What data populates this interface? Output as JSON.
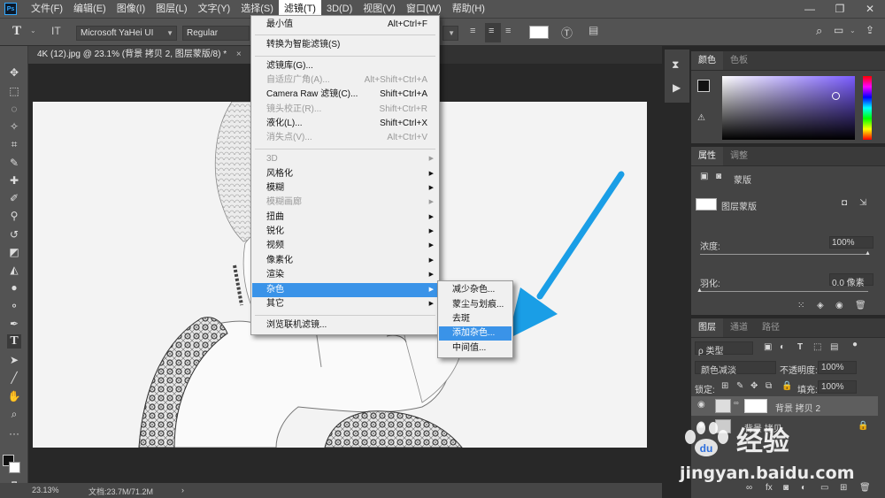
{
  "menubar": {
    "logo": "Ps",
    "items": [
      "文件(F)",
      "编辑(E)",
      "图像(I)",
      "图层(L)",
      "文字(Y)",
      "选择(S)",
      "滤镜(T)",
      "3D(D)",
      "视图(V)",
      "窗口(W)",
      "帮助(H)"
    ],
    "active_index": 6
  },
  "options": {
    "font_family": "Microsoft YaHei UI",
    "font_style": "Regular",
    "text_color": "#ffffff"
  },
  "document": {
    "tab_title": "4K (12).jpg @ 23.1% (背景 拷贝 2, 图层蒙版/8) *",
    "tab_close": "×"
  },
  "status": {
    "zoom": "23.13%",
    "doc_size": "文档:23.7M/71.2M",
    "arrow": "›"
  },
  "filter_menu": {
    "items": [
      {
        "label": "最小值",
        "shortcut": "Alt+Ctrl+F",
        "disabled": false
      },
      {
        "label": "转换为智能滤镜(S)",
        "shortcut": "",
        "disabled": false
      },
      {
        "label": "滤镜库(G)...",
        "shortcut": "",
        "disabled": false
      },
      {
        "label": "自适应广角(A)...",
        "shortcut": "Alt+Shift+Ctrl+A",
        "disabled": true
      },
      {
        "label": "Camera Raw 滤镜(C)...",
        "shortcut": "Shift+Ctrl+A",
        "disabled": false
      },
      {
        "label": "镜头校正(R)...",
        "shortcut": "Shift+Ctrl+R",
        "disabled": true
      },
      {
        "label": "液化(L)...",
        "shortcut": "Shift+Ctrl+X",
        "disabled": false
      },
      {
        "label": "消失点(V)...",
        "shortcut": "Alt+Ctrl+V",
        "disabled": true
      },
      {
        "label": "3D",
        "submenu": true,
        "disabled": true
      },
      {
        "label": "风格化",
        "submenu": true,
        "disabled": false
      },
      {
        "label": "模糊",
        "submenu": true,
        "disabled": false
      },
      {
        "label": "模糊画廊",
        "submenu": true,
        "disabled": true
      },
      {
        "label": "扭曲",
        "submenu": true,
        "disabled": false
      },
      {
        "label": "锐化",
        "submenu": true,
        "disabled": false
      },
      {
        "label": "视频",
        "submenu": true,
        "disabled": false
      },
      {
        "label": "像素化",
        "submenu": true,
        "disabled": false
      },
      {
        "label": "渲染",
        "submenu": true,
        "disabled": false
      },
      {
        "label": "杂色",
        "submenu": true,
        "disabled": false,
        "highlighted": true
      },
      {
        "label": "其它",
        "submenu": true,
        "disabled": false
      },
      {
        "label": "浏览联机滤镜...",
        "shortcut": "",
        "disabled": false
      }
    ],
    "submenu_arrow": "▶"
  },
  "noise_submenu": {
    "items": [
      "减少杂色...",
      "蒙尘与划痕...",
      "去斑",
      "添加杂色...",
      "中间值..."
    ],
    "highlighted_index": 3
  },
  "color_panel": {
    "tabs": [
      "颜色",
      "色板"
    ],
    "hue_color": "#7a5cff"
  },
  "properties_panel": {
    "tabs": [
      "属性",
      "调整"
    ],
    "mask_label": "蒙版",
    "layer_mask_label": "图层蒙版",
    "density_label": "浓度:",
    "density_value": "100%",
    "feather_label": "羽化:",
    "feather_value": "0.0 像素",
    "density_fraction": 1.0,
    "feather_fraction": 0.0
  },
  "layers_panel": {
    "tabs": [
      "图层",
      "通道",
      "路径"
    ],
    "filter_kind": "ρ 类型",
    "blend_mode": "颜色减淡",
    "opacity_label": "不透明度:",
    "opacity_value": "100%",
    "lock_label": "锁定:",
    "fill_label": "填充:",
    "fill_value": "100%",
    "layers": [
      {
        "name": "背景 拷贝 2",
        "selected": true
      },
      {
        "name": "背景 拷贝",
        "selected": false
      }
    ]
  },
  "watermark": {
    "brand": "经验",
    "url": "jingyan.baidu.com"
  },
  "colors": {
    "accent": "#3a93e8",
    "arrow": "#1a9ee6",
    "bg_dark": "#282828",
    "panel": "#535353"
  }
}
